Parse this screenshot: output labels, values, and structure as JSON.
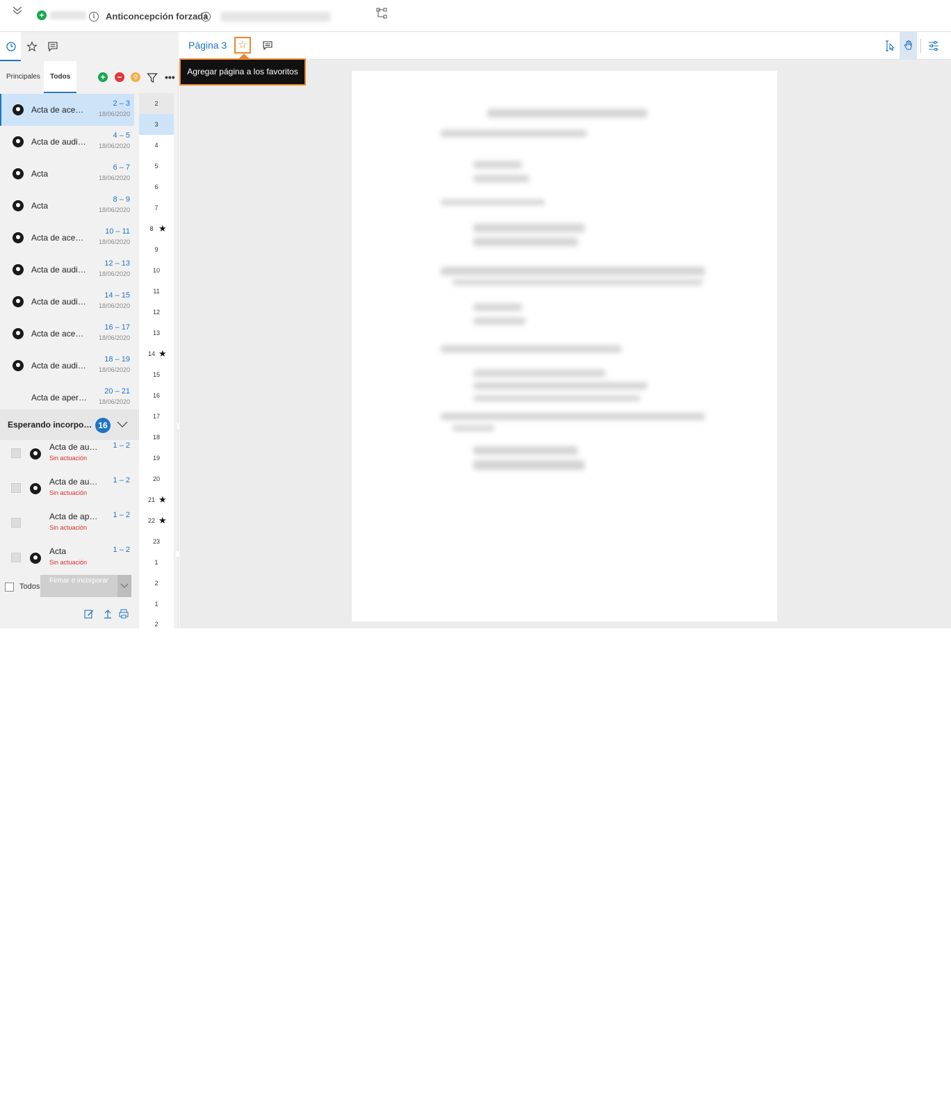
{
  "topbar": {
    "title": "Anticoncepción forzada"
  },
  "left_panel": {
    "subtabs": [
      "Principales",
      "Todos"
    ],
    "active_subtab": "Todos",
    "documents": [
      {
        "name": "Acta de ace…",
        "pages": "2 – 3",
        "date": "18/06/2020",
        "icon": "stamp-icon",
        "selected": true
      },
      {
        "name": "Acta de audi…",
        "pages": "4 – 5",
        "date": "18/06/2020",
        "icon": "stamp-icon"
      },
      {
        "name": "Acta",
        "pages": "6 – 7",
        "date": "18/06/2020",
        "icon": "stamp-icon"
      },
      {
        "name": "Acta",
        "pages": "8 – 9",
        "date": "18/06/2020",
        "icon": "stamp-icon"
      },
      {
        "name": "Acta de ace…",
        "pages": "10 – 11",
        "date": "18/06/2020",
        "icon": "stamp-icon"
      },
      {
        "name": "Acta de audi…",
        "pages": "12 – 13",
        "date": "18/06/2020",
        "icon": "stamp-icon"
      },
      {
        "name": "Acta de audi…",
        "pages": "14 – 15",
        "date": "18/06/2020",
        "icon": "stamp-icon"
      },
      {
        "name": "Acta de ace…",
        "pages": "16 – 17",
        "date": "18/06/2020",
        "icon": "stamp-icon"
      },
      {
        "name": "Acta de audi…",
        "pages": "18 – 19",
        "date": "18/06/2020",
        "icon": "stamp-icon"
      },
      {
        "name": "Acta de aper…",
        "pages": "20 – 21",
        "date": "18/06/2020",
        "icon": "document-icon"
      }
    ],
    "pending": {
      "title": "Esperando incorpo…",
      "count": "16",
      "items": [
        {
          "name": "Acta de au…",
          "status": "Sin actuación",
          "pages": "1 – 2",
          "icon": "stamp-icon"
        },
        {
          "name": "Acta de au…",
          "status": "Sin actuación",
          "pages": "1 – 2",
          "icon": "stamp-icon"
        },
        {
          "name": "Acta de ap…",
          "status": "Sin actuación",
          "pages": "1 – 2",
          "icon": "document-icon"
        },
        {
          "name": "Acta",
          "status": "Sin actuación",
          "pages": "1 – 2",
          "icon": "stamp-icon"
        }
      ]
    },
    "footer": {
      "select_all_label": "Todos",
      "sign_button_label": "Firmar e incorporar"
    }
  },
  "page_numbers": [
    {
      "n": "2"
    },
    {
      "n": "3",
      "selected": true
    },
    {
      "n": "4"
    },
    {
      "n": "5"
    },
    {
      "n": "6"
    },
    {
      "n": "7"
    },
    {
      "n": "8",
      "favorite": true
    },
    {
      "n": "9"
    },
    {
      "n": "10"
    },
    {
      "n": "11"
    },
    {
      "n": "12"
    },
    {
      "n": "13"
    },
    {
      "n": "14",
      "favorite": true
    },
    {
      "n": "15"
    },
    {
      "n": "16"
    },
    {
      "n": "17"
    },
    {
      "n": "18"
    },
    {
      "n": "19"
    },
    {
      "n": "20"
    },
    {
      "n": "21",
      "favorite": true
    },
    {
      "n": "22",
      "favorite": true
    },
    {
      "n": "23"
    },
    {
      "n": "1"
    },
    {
      "n": "2"
    },
    {
      "n": "1"
    },
    {
      "n": "2"
    }
  ],
  "viewer": {
    "page_label": "Página 3",
    "tooltip": "Agregar página a los favoritos"
  },
  "colors": {
    "accent": "#1f74c4",
    "highlight": "#e8872d",
    "selected_row": "#cde3f8",
    "status_red": "#d9302c"
  }
}
